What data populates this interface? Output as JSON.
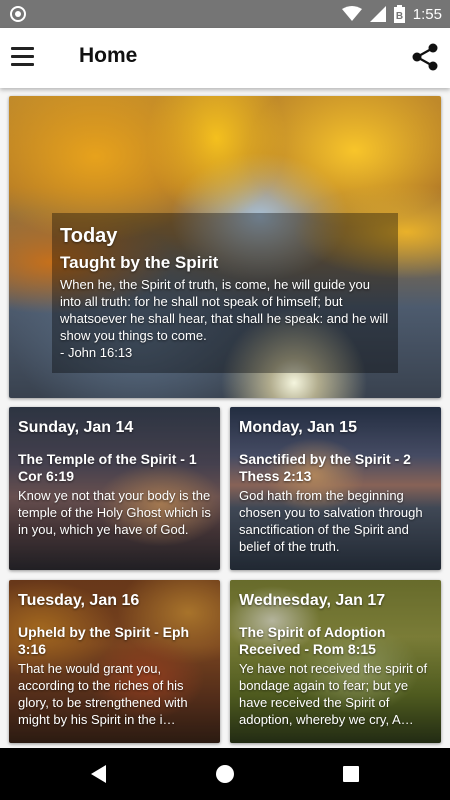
{
  "status_bar": {
    "time": "1:55",
    "battery_label": "B",
    "icons": [
      "circle-icon",
      "wifi-icon",
      "signal-icon",
      "battery-icon"
    ]
  },
  "app_bar": {
    "title": "Home",
    "icons": [
      "menu-icon",
      "share-icon"
    ]
  },
  "featured": {
    "heading": "Today",
    "title": "Taught by the Spirit",
    "text": "When he, the Spirit of truth, is come, he will guide you into all truth: for he shall not speak of himself; but whatsoever he shall hear, that shall he speak: and he will show you things to come.",
    "reference": "- John 16:13"
  },
  "cards": [
    {
      "date": "Sunday, Jan 14",
      "title": "The Temple of the Spirit - 1 Cor 6:19",
      "text": "Know ye not that your body is the temple of the Holy Ghost which is in you, which ye have of God."
    },
    {
      "date": "Monday, Jan 15",
      "title": "Sanctified by the Spirit - 2 Thess 2:13",
      "text": "God hath from the beginning chosen you to salvation through sanctification of the Spirit and belief of the truth."
    },
    {
      "date": "Tuesday, Jan 16",
      "title": "Upheld by the Spirit - Eph 3:16",
      "text": "That he would grant you, according to the riches of his glory, to be strengthened with might by his Spirit in the i…"
    },
    {
      "date": "Wednesday, Jan 17",
      "title": "The Spirit of Adoption Received - Rom 8:15",
      "text": "Ye have not received the spirit of bondage again to fear; but ye have received the Spirit of adoption, whereby we cry, A…"
    }
  ],
  "nav_bar": {
    "icons": [
      "back-icon",
      "home-icon",
      "recents-icon"
    ]
  },
  "colors": {
    "status_bar": "#757575",
    "app_bar": "#ffffff",
    "nav_bar": "#000000"
  }
}
